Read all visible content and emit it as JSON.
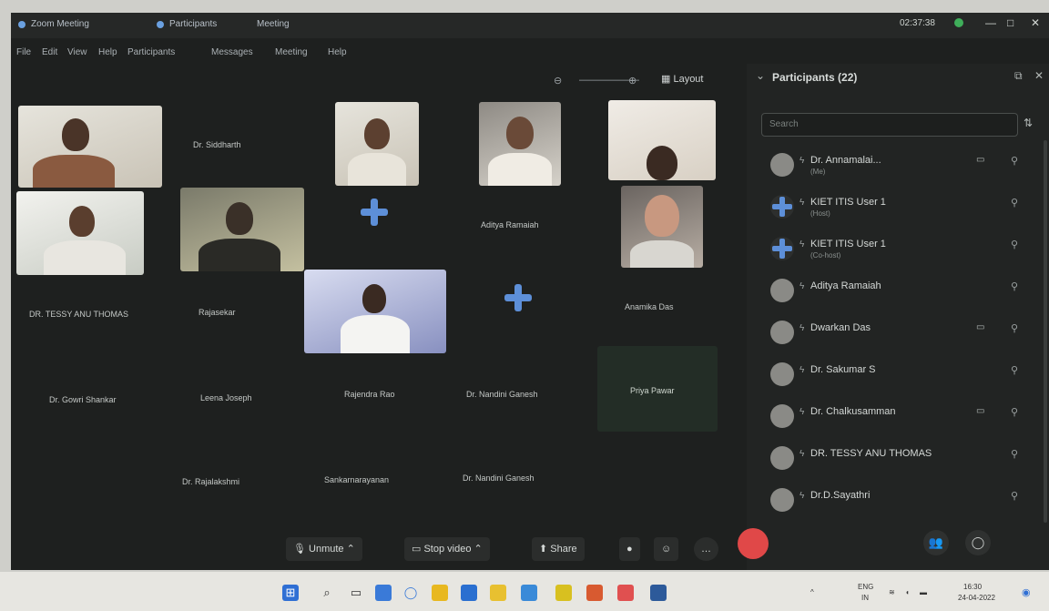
{
  "window": {
    "tabs": [
      "Zoom Meeting",
      "Participants",
      "Meeting"
    ],
    "clock": "02:37:38",
    "controls": [
      "—",
      "□",
      "✕"
    ]
  },
  "menu": [
    "File",
    "Edit",
    "View",
    "Help",
    "Participants",
    "Messages",
    "Meeting",
    "Help"
  ],
  "layout_label": "Layout",
  "tiles": {
    "names": [
      "Dr. Siddharth",
      "Aditya Ramaiah",
      "DR. TESSY ANU THOMAS",
      "Rajasekar",
      "Anamika Das",
      "Rajendra Rao",
      "Priya Pawar",
      "Dr. Gowri Shankar",
      "Leena Joseph",
      "Dr. Nandini Ganesh",
      "Dr. Rajalakshmi",
      "Sankarnarayanan"
    ]
  },
  "participants": {
    "title": "Participants (22)",
    "search_placeholder": "Search",
    "list": [
      {
        "name": "Dr. Annamalai...",
        "sub": "(Me)",
        "avatar": "photo",
        "camera": true
      },
      {
        "name": "KIET ITIS User 1",
        "sub": "(Host)",
        "avatar": "zoom",
        "camera": false
      },
      {
        "name": "KIET ITIS User 1",
        "sub": "(Co-host)",
        "avatar": "zoom",
        "camera": false
      },
      {
        "name": "Aditya Ramaiah",
        "sub": "",
        "avatar": "photo",
        "camera": false
      },
      {
        "name": "Dwarkan Das",
        "sub": "",
        "avatar": "photo",
        "camera": true
      },
      {
        "name": "Dr. Sakumar S",
        "sub": "",
        "avatar": "photo",
        "camera": false
      },
      {
        "name": "Dr. Chalkusamman",
        "sub": "",
        "avatar": "photo",
        "camera": true
      },
      {
        "name": "DR. TESSY ANU THOMAS",
        "sub": "",
        "avatar": "photo",
        "camera": false
      },
      {
        "name": "Dr.D.Sayathri",
        "sub": "",
        "avatar": "photo",
        "camera": false
      }
    ]
  },
  "controls": {
    "unmute": "Unmute",
    "stop_video": "Stop video",
    "share": "Share"
  },
  "taskbar": {
    "lang": "ENG",
    "region": "IN",
    "time": "16:30",
    "date": "24-04-2022"
  }
}
